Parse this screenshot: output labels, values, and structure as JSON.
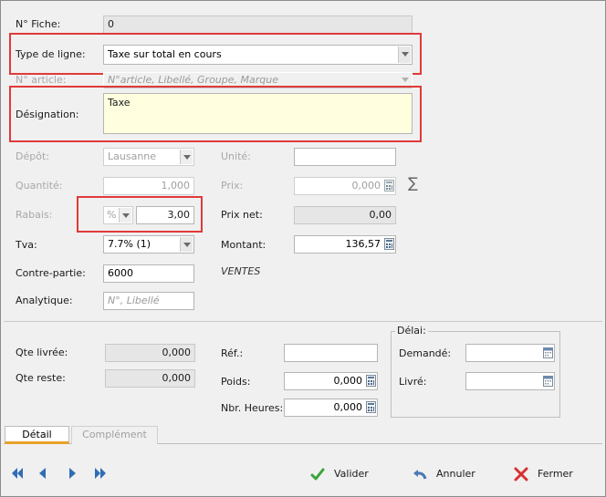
{
  "form": {
    "fiche_label": "N° Fiche:",
    "fiche_value": "0",
    "type_label": "Type de ligne:",
    "type_value": "Taxe sur total en cours",
    "article_label": "N° article:",
    "article_placeholder": "N°article, Libellé, Groupe, Marque",
    "designation_label": "Désignation:",
    "designation_value": "Taxe",
    "depot_label": "Dépôt:",
    "depot_value": "Lausanne",
    "unite_label": "Unité:",
    "quantite_label": "Quantité:",
    "quantite_value": "1,000",
    "prix_label": "Prix:",
    "prix_value": "0,000",
    "sigma": "∑",
    "rabais_label": "Rabais:",
    "rabais_unit": "%",
    "rabais_value": "3,00",
    "prix_net_label": "Prix net:",
    "prix_net_value": "0,00",
    "tva_label": "Tva:",
    "tva_value": "7.7% (1)",
    "montant_label": "Montant:",
    "montant_value": "136,57",
    "contre_label": "Contre-partie:",
    "contre_value": "6000",
    "ventes_text": "VENTES",
    "analytique_label": "Analytique:",
    "analytique_placeholder": "N°, Libellé"
  },
  "lower": {
    "qte_livree_label": "Qte livrée:",
    "qte_livree_value": "0,000",
    "qte_reste_label": "Qte reste:",
    "qte_reste_value": "0,000",
    "ref_label": "Réf.:",
    "poids_label": "Poids:",
    "poids_value": "0,000",
    "heures_label": "Nbr. Heures:",
    "heures_value": "0,000",
    "delai_legend": "Délai:",
    "demande_label": "Demandé:",
    "livre_label": "Livré:"
  },
  "tabs": [
    {
      "label": "Détail"
    },
    {
      "label": "Complément"
    }
  ],
  "buttons": {
    "valider": "Valider",
    "annuler": "Annuler",
    "fermer": "Fermer"
  },
  "icons": [
    "first-icon",
    "prev-icon",
    "next-icon",
    "last-icon",
    "calendar-icon",
    "check-icon",
    "undo-icon",
    "close-icon"
  ]
}
